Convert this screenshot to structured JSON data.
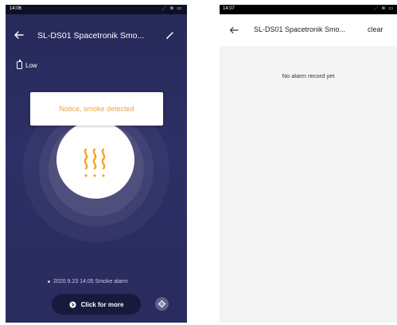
{
  "left_screen": {
    "status_bar": {
      "time": "14:06",
      "system_icons": "⋰ ≋ ▭"
    },
    "title": "SL-DS01 Spacetronik Smo...",
    "battery": {
      "label": "Low"
    },
    "notice": "Notice, smoke detected",
    "record": "2020.9.23 14:05 Smoke alarm",
    "more_button": "Click for more",
    "colors": {
      "notice_text": "#f2a23a",
      "smoke_icon": "#f5a623",
      "background": "#2a2c5f"
    }
  },
  "right_screen": {
    "status_bar": {
      "time": "14:07",
      "system_icons": "⋰ ≋ ▭"
    },
    "title": "SL-DS01 Spacetronik Smo...",
    "clear_button": "clear",
    "empty_message": "No alarm record yet"
  }
}
